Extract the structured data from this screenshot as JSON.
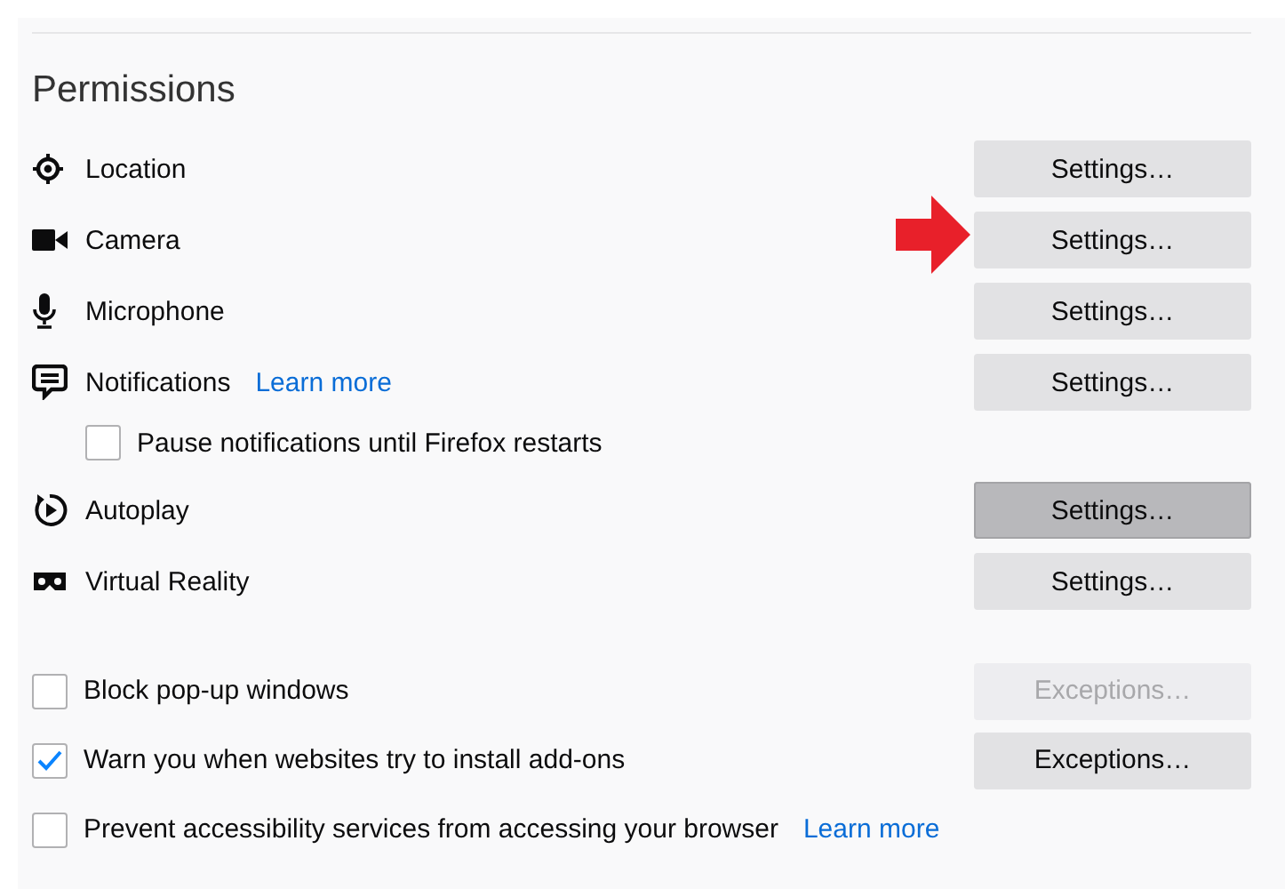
{
  "heading": "Permissions",
  "permissions": [
    {
      "kind": "setting",
      "label": "Location",
      "button": {
        "label": "Settings…",
        "hovered": false
      }
    },
    {
      "kind": "setting",
      "label": "Camera",
      "button": {
        "label": "Settings…",
        "hovered": false
      }
    },
    {
      "kind": "setting",
      "label": "Microphone",
      "button": {
        "label": "Settings…",
        "hovered": false
      }
    },
    {
      "kind": "setting",
      "label": "Notifications",
      "link": "Learn more",
      "button": {
        "label": "Settings…",
        "hovered": false
      }
    },
    {
      "kind": "checkbox",
      "label": "Pause notifications until Firefox restarts",
      "checked": false
    },
    {
      "kind": "setting",
      "label": "Autoplay",
      "button": {
        "label": "Settings…",
        "hovered": true
      }
    },
    {
      "kind": "setting",
      "label": "Virtual Reality",
      "button": {
        "label": "Settings…",
        "hovered": false
      }
    }
  ],
  "options": [
    {
      "label": "Block pop-up windows",
      "checked": false,
      "button": {
        "label": "Exceptions…",
        "disabled": true
      }
    },
    {
      "label": "Warn you when websites try to install add-ons",
      "checked": true,
      "button": {
        "label": "Exceptions…",
        "disabled": false
      }
    },
    {
      "label": "Prevent accessibility services from accessing your browser",
      "checked": false,
      "link": "Learn more"
    }
  ]
}
